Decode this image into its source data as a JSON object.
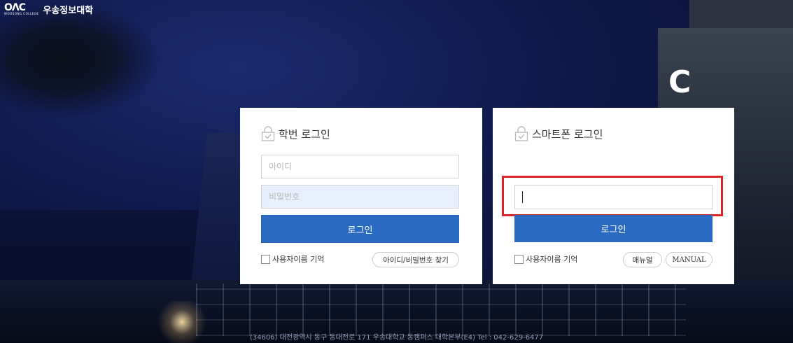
{
  "header": {
    "logo_mark": "OΛC",
    "logo_sub": "WOOSONG COLLEGE",
    "school_name": "우송정보대학"
  },
  "background": {
    "building_letter": "C"
  },
  "student_login": {
    "title": "학번 로그인",
    "id_placeholder": "아이디",
    "password_placeholder": "비밀번호",
    "login_label": "로그인",
    "remember_label": "사용자이름 기억",
    "find_label": "아이디/비밀번호 찾기"
  },
  "phone_login": {
    "title": "스마트폰 로그인",
    "input_value": "",
    "login_label": "로그인",
    "remember_label": "사용자이름 기억",
    "manual_ko_label": "매뉴얼",
    "manual_en_label": "MANUAL"
  },
  "footer": {
    "address": "(34606) 대전광역시 동구 동대전로 171 우송대학교 동캠퍼스 대학본부(E4)  Tel : 042-629-6477"
  },
  "colors": {
    "accent": "#2a6bc1",
    "highlight": "#e0242b"
  }
}
